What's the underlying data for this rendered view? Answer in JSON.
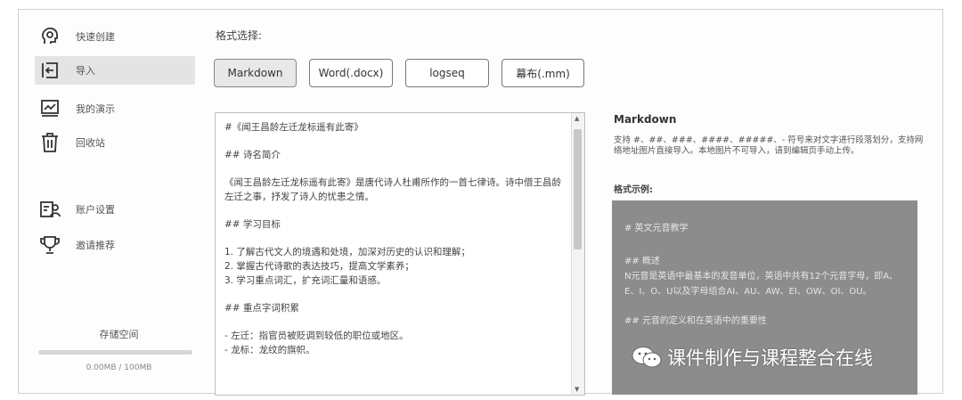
{
  "sidebar": {
    "items": [
      {
        "label": "快速创建",
        "icon": "brain-icon"
      },
      {
        "label": "导入",
        "icon": "import-icon"
      },
      {
        "label": "我的演示",
        "icon": "presentation-icon"
      },
      {
        "label": "回收站",
        "icon": "trash-icon"
      },
      {
        "label": "账户设置",
        "icon": "account-icon"
      },
      {
        "label": "邀请推荐",
        "icon": "trophy-icon"
      }
    ],
    "active": "导入",
    "storage": {
      "title": "存储空间",
      "usage": "0.00MB / 100MB",
      "fraction": 0.0
    }
  },
  "main": {
    "format_label": "格式选择:",
    "formats": [
      "Markdown",
      "Word(.docx)",
      "logseq",
      "幕布(.mm)"
    ],
    "selected_format": "Markdown",
    "editor_lines": [
      "#《闻王昌龄左迁龙标遥有此寄》",
      "## 诗名简介",
      "《闻王昌龄左迁龙标遥有此寄》是唐代诗人杜甫所作的一首七律诗。诗中借王昌龄左迁之事，抒发了诗人的忧患之情。",
      "## 学习目标",
      "1. 了解古代文人的境遇和处境，加深对历史的认识和理解；\n2. 掌握古代诗歌的表达技巧，提高文学素养；\n3. 学习重点词汇，扩充词汇量和语感。",
      "## 重点字词积累",
      "- 左迁：指官员被贬调到较低的职位或地区。\n- 龙标：龙纹的旗帜。"
    ]
  },
  "help": {
    "title": "Markdown",
    "description": "支持 #、##、###、####、#####、- 符号来对文字进行段落划分，支持网络地址图片直接导入。本地图片不可导入，请到编辑页手动上传。",
    "example_label": "格式示例:",
    "example_lines": [
      "# 英文元音教学",
      "## 概述",
      "N元音是英语中最基本的发音单位，英语中共有12个元音字母，即A、E、I、O、U以及字母组合AI、AU、AW、EI、OW、OI、OU。",
      "## 元音的定义和在英语中的重要性"
    ]
  },
  "watermark": {
    "text": "课件制作与课程整合在线",
    "icon": "wechat-icon"
  }
}
